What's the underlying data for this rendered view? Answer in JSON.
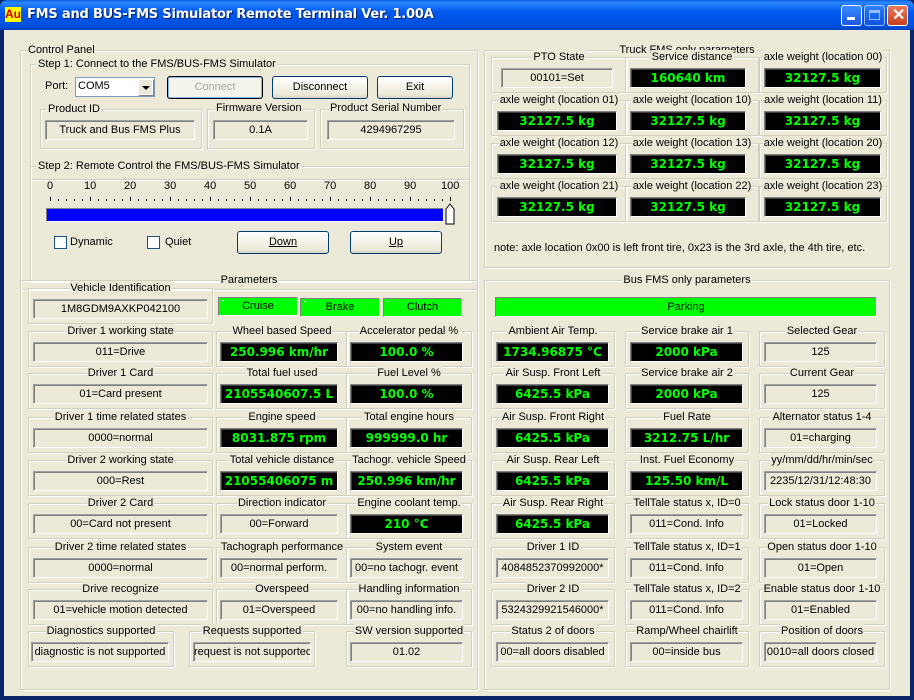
{
  "window": {
    "title": "FMS and BUS-FMS Simulator Remote Terminal Ver. 1.00A",
    "icon_text": "Au",
    "controls": [
      "minimize",
      "maximize",
      "close"
    ]
  },
  "control_panel": {
    "label": "Control Panel",
    "step1": {
      "label": "Step 1: Connect to the FMS/BUS-FMS Simulator",
      "port_label": "Port:",
      "port_value": "COM5",
      "connect_label": "Connect",
      "disconnect_label": "Disconnect",
      "exit_label": "Exit",
      "product_id": {
        "label": "Product ID",
        "value": "Truck and Bus FMS Plus"
      },
      "firmware_version": {
        "label": "Firmware Version",
        "value": "0.1A"
      },
      "serial_number": {
        "label": "Product Serial Number",
        "value": "4294967295"
      }
    },
    "step2": {
      "label": "Step 2: Remote Control the FMS/BUS-FMS Simulator",
      "scale_labels": [
        "0",
        "10",
        "20",
        "30",
        "40",
        "50",
        "60",
        "70",
        "80",
        "90",
        "100"
      ],
      "slider_value_percent": 100,
      "dynamic_label": "Dynamic",
      "dynamic_checked": false,
      "quiet_label": "Quiet",
      "quiet_checked": false,
      "down_label": "Down",
      "up_label": "Up"
    }
  },
  "truck": {
    "label": "Truck FMS only parameters",
    "pto": {
      "label": "PTO State",
      "value": "00101=Set"
    },
    "service_distance": {
      "label": "Service distance",
      "value": "160640 km"
    },
    "axles": [
      {
        "label": "axle weight (location 00)",
        "value": "32127.5 kg"
      },
      {
        "label": "axle weight (location 01)",
        "value": "32127.5 kg"
      },
      {
        "label": "axle weight (location 10)",
        "value": "32127.5 kg"
      },
      {
        "label": "axle weight (location 11)",
        "value": "32127.5 kg"
      },
      {
        "label": "axle weight (location 12)",
        "value": "32127.5 kg"
      },
      {
        "label": "axle weight (location 13)",
        "value": "32127.5 kg"
      },
      {
        "label": "axle weight (location 20)",
        "value": "32127.5 kg"
      },
      {
        "label": "axle weight (location 21)",
        "value": "32127.5 kg"
      },
      {
        "label": "axle weight (location 22)",
        "value": "32127.5 kg"
      },
      {
        "label": "axle weight (location 23)",
        "value": "32127.5 kg"
      }
    ],
    "note": "note: axle location 0x00 is left front tire, 0x23 is the 3rd axle, the 4th tire, etc."
  },
  "parameters": {
    "label": "Parameters",
    "indicators": {
      "cruise": "Cruise",
      "brake": "Brake",
      "clutch": "Clutch"
    },
    "indicator_color": "#00ff00",
    "vehicle_id": {
      "label": "Vehicle Identification",
      "value": "1M8GDM9AXKP042100"
    },
    "driver1_working_state": {
      "label": "Driver 1 working state",
      "value": "011=Drive"
    },
    "driver1_card": {
      "label": "Driver 1 Card",
      "value": "01=Card present"
    },
    "driver1_time_states": {
      "label": "Driver 1 time related states",
      "value": "0000=normal"
    },
    "driver2_working_state": {
      "label": "Driver 2 working state",
      "value": "000=Rest"
    },
    "driver2_card": {
      "label": "Driver 2 Card",
      "value": "00=Card not present"
    },
    "driver2_time_states": {
      "label": "Driver 2 time related states",
      "value": "0000=normal"
    },
    "drive_recognize": {
      "label": "Drive recognize",
      "value": "01=vehicle motion detected"
    },
    "diagnostics": {
      "label": "Diagnostics supported",
      "value": "diagnostic is not supported"
    },
    "requests": {
      "label": "Requests supported",
      "value": "request is not supported"
    },
    "wheel_speed": {
      "label": "Wheel based Speed",
      "value": "250.996 km/hr"
    },
    "accel_pedal": {
      "label": "Accelerator pedal %",
      "value": "100.0 %"
    },
    "total_fuel": {
      "label": "Total fuel used",
      "value": "2105540607.5 L"
    },
    "fuel_level": {
      "label": "Fuel Level %",
      "value": "100.0 %"
    },
    "engine_speed": {
      "label": "Engine speed",
      "value": "8031.875 rpm"
    },
    "engine_hours": {
      "label": "Total engine hours",
      "value": "999999.0 hr"
    },
    "total_distance": {
      "label": "Total vehicle distance",
      "value": "21055406075 m"
    },
    "tacho_speed": {
      "label": "Tachogr. vehicle Speed",
      "value": "250.996 km/hr"
    },
    "direction": {
      "label": "Direction indicator",
      "value": "00=Forward"
    },
    "coolant": {
      "label": "Engine coolant temp.",
      "value": "210 °C"
    },
    "tacho_perf": {
      "label": "Tachograph performance",
      "value": "00=normal perform."
    },
    "system_event": {
      "label": "System event",
      "value": "00=no tachogr. event"
    },
    "overspeed": {
      "label": "Overspeed",
      "value": "01=Overspeed"
    },
    "handling": {
      "label": "Handling information",
      "value": "00=no handling info."
    },
    "sw_version": {
      "label": "SW version supported",
      "value": "01.02"
    }
  },
  "bus": {
    "label": "Bus FMS only parameters",
    "parking": "Parking",
    "ambient_temp": {
      "label": "Ambient Air Temp.",
      "value": "1734.96875 °C"
    },
    "brake_air1": {
      "label": "Service brake air 1",
      "value": "2000 kPa"
    },
    "selected_gear": {
      "label": "Selected Gear",
      "value": "125"
    },
    "susp_front_left": {
      "label": "Air Susp. Front Left",
      "value": "6425.5 kPa"
    },
    "brake_air2": {
      "label": "Service brake air 2",
      "value": "2000 kPa"
    },
    "current_gear": {
      "label": "Current Gear",
      "value": "125"
    },
    "susp_front_right": {
      "label": "Air Susp. Front Right",
      "value": "6425.5 kPa"
    },
    "fuel_rate": {
      "label": "Fuel Rate",
      "value": "3212.75 L/hr"
    },
    "alternator": {
      "label": "Alternator status 1-4",
      "value": "01=charging"
    },
    "susp_rear_left": {
      "label": "Air Susp. Rear Left",
      "value": "6425.5 kPa"
    },
    "fuel_economy": {
      "label": "Inst. Fuel Economy",
      "value": "125.50 km/L"
    },
    "datetime": {
      "label": "yy/mm/dd/hr/min/sec",
      "value": "2235/12/31/12:48:30"
    },
    "susp_rear_right": {
      "label": "Air Susp. Rear Right",
      "value": "6425.5 kPa"
    },
    "telltale0": {
      "label": "TellTale status x, ID=0",
      "value": "011=Cond. Info"
    },
    "lock_door": {
      "label": "Lock status door 1-10",
      "value": "01=Locked"
    },
    "driver1_id": {
      "label": "Driver 1 ID",
      "value": "4084852370992000*"
    },
    "telltale1": {
      "label": "TellTale status x, ID=1",
      "value": "011=Cond. Info"
    },
    "open_door": {
      "label": "Open status door 1-10",
      "value": "01=Open"
    },
    "driver2_id": {
      "label": "Driver 2 ID",
      "value": "5324329921546000*"
    },
    "telltale2": {
      "label": "TellTale status x, ID=2",
      "value": "011=Cond. Info"
    },
    "enable_door": {
      "label": "Enable status door 1-10",
      "value": "01=Enabled"
    },
    "status2_doors": {
      "label": "Status 2 of doors",
      "value": "00=all doors disabled"
    },
    "ramp": {
      "label": "Ramp/Wheel chairlift",
      "value": "00=inside bus"
    },
    "door_position": {
      "label": "Position of doors",
      "value": "0010=all doors closed"
    }
  }
}
